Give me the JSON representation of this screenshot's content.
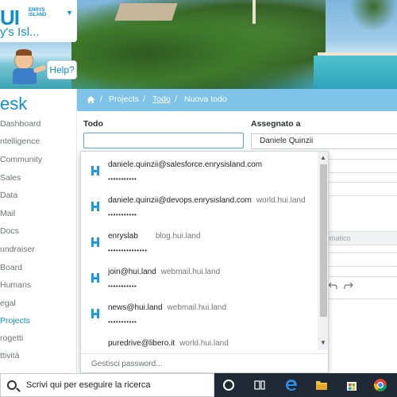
{
  "logo": {
    "mark": "UI",
    "brand": "ENRYS ISLAND",
    "subtitle": "y's Isl..."
  },
  "help": {
    "label": "Help?"
  },
  "sidebar": {
    "title": "esk",
    "items": [
      {
        "label": "Dashboard",
        "active": false
      },
      {
        "label": "ntelligence",
        "active": false
      },
      {
        "label": "Community",
        "active": false
      },
      {
        "label": "Sales",
        "active": false
      },
      {
        "label": "Data",
        "active": false
      },
      {
        "label": "Mail",
        "active": false
      },
      {
        "label": "Docs",
        "active": false
      },
      {
        "label": "undraiser",
        "active": false
      },
      {
        "label": "Board",
        "active": false
      },
      {
        "label": "Humans",
        "active": false
      },
      {
        "label": "egal",
        "active": false
      },
      {
        "label": "Projects",
        "active": true
      },
      {
        "label": "rogetti",
        "active": false
      },
      {
        "label": "ttività",
        "active": false
      }
    ]
  },
  "breadcrumb": {
    "home_icon": "home-icon",
    "sep": "/",
    "items": [
      "Projects",
      "Todo",
      "Nuova todo"
    ]
  },
  "form": {
    "todo_label": "Todo",
    "todo_value": "",
    "assignee_label": "Assegnato a",
    "assignee_value": "Daniele Quinzii",
    "auto_field_text": "omatico",
    "undo_icon": "undo-icon",
    "redo_icon": "redo-icon"
  },
  "autofill": {
    "items": [
      {
        "user": "daniele.quinzii@salesforce.enrysisland.com",
        "site": "",
        "password_mask": "•••••••••••"
      },
      {
        "user": "daniele.quinzii@devops.enrysisland.com",
        "site": "world.hui.land",
        "password_mask": "•••••••••••"
      },
      {
        "user": "enryslab",
        "site": "blog.hui.land",
        "password_mask": "•••••••••••••••"
      },
      {
        "user": "join@hui.land",
        "site": "webmail.hui.land",
        "password_mask": "•••••••••••"
      },
      {
        "user": "news@hui.land",
        "site": "webmail.hui.land",
        "password_mask": "•••••••••••"
      },
      {
        "user": "puredrive@libero.it",
        "site": "world.hui.land",
        "password_mask": ""
      }
    ],
    "footer": "Gestisci password..."
  },
  "taskbar": {
    "search_placeholder": "Scrivi qui per eseguire la ricerca",
    "icons": [
      "cortana-icon",
      "task-view-icon",
      "edge-icon",
      "file-explorer-icon",
      "store-icon",
      "chrome-icon"
    ]
  },
  "colors": {
    "brand_blue": "#0f8fd0",
    "crumbbar": "#7fc3e8",
    "taskbar": "#1f2a36"
  }
}
